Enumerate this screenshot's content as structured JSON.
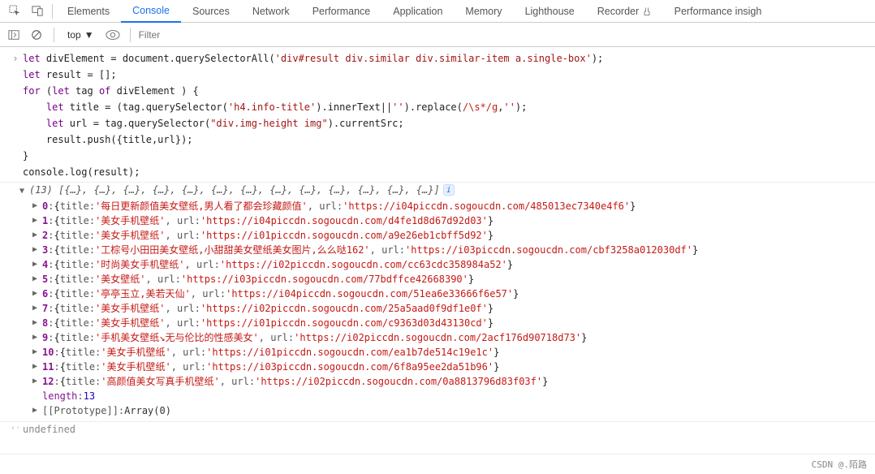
{
  "tabs": {
    "elements": "Elements",
    "console": "Console",
    "sources": "Sources",
    "network": "Network",
    "performance": "Performance",
    "application": "Application",
    "memory": "Memory",
    "lighthouse": "Lighthouse",
    "recorder": "Recorder",
    "perf_insights": "Performance insigh"
  },
  "toolbar": {
    "context": "top",
    "filter_placeholder": "Filter"
  },
  "code": {
    "l1a": "let",
    "l1b": " divElement = document.querySelectorAll(",
    "l1c": "'div#result div.similar div.similar-item a.single-box'",
    "l1d": ");",
    "l2a": "let",
    "l2b": " result = [];",
    "l3a": "for",
    "l3b": " (",
    "l3c": "let",
    "l3d": " tag ",
    "l3e": "of",
    "l3f": " divElement ) {",
    "l4a": "    let",
    "l4b": " title = (tag.querySelector(",
    "l4c": "'h4.info-title'",
    "l4d": ").innerText||",
    "l4e": "''",
    "l4f": ").replace(",
    "l4g": "/\\s*/g",
    "l4h": ",",
    "l4i": "''",
    "l4j": ");",
    "l5a": "    let",
    "l5b": " url = tag.querySelector(",
    "l5c": "\"div.img-height img\"",
    "l5d": ").currentSrc;",
    "l6": "    result.push({title,url});",
    "l7": "}",
    "l8": "console.log(result);"
  },
  "result": {
    "count": "(13)",
    "preview": " [{…}, {…}, {…}, {…}, {…}, {…}, {…}, {…}, {…}, {…}, {…}, {…}, {…}]",
    "items": [
      {
        "idx": "0",
        "title": "'每日更新颜值美女壁纸,男人看了都会珍藏颜值'",
        "url": "'https://i04piccdn.sogoucdn.com/485013ec7340e4f6'"
      },
      {
        "idx": "1",
        "title": "'美女手机壁纸'",
        "url": "'https://i04piccdn.sogoucdn.com/d4fe1d8d67d92d03'"
      },
      {
        "idx": "2",
        "title": "'美女手机壁纸'",
        "url": "'https://i01piccdn.sogoucdn.com/a9e26eb1cbff5d92'"
      },
      {
        "idx": "3",
        "title": "'工棕号小田田美女壁纸,小甜甜美女壁纸美女图片,么么哒162'",
        "url": "'https://i03piccdn.sogoucdn.com/cbf3258a012030df'"
      },
      {
        "idx": "4",
        "title": "'时尚美女手机壁纸'",
        "url": "'https://i02piccdn.sogoucdn.com/cc63cdc358984a52'"
      },
      {
        "idx": "5",
        "title": "'美女壁纸'",
        "url": "'https://i03piccdn.sogoucdn.com/77bdffce42668390'"
      },
      {
        "idx": "6",
        "title": "'亭亭玉立,美若天仙'",
        "url": "'https://i04piccdn.sogoucdn.com/51ea6e33666f6e57'"
      },
      {
        "idx": "7",
        "title": "'美女手机壁纸'",
        "url": "'https://i02piccdn.sogoucdn.com/25a5aad0f9df1e0f'"
      },
      {
        "idx": "8",
        "title": "'美女手机壁纸'",
        "url": "'https://i01piccdn.sogoucdn.com/c9363d03d43130cd'"
      },
      {
        "idx": "9",
        "title": "'手机美女壁纸↘无与伦比的性感美女'",
        "url": "'https://i02piccdn.sogoucdn.com/2acf176d90718d73'"
      },
      {
        "idx": "10",
        "title": "'美女手机壁纸'",
        "url": "'https://i01piccdn.sogoucdn.com/ea1b7de514c19e1c'"
      },
      {
        "idx": "11",
        "title": "'美女手机壁纸'",
        "url": "'https://i03piccdn.sogoucdn.com/6f8a95ee2da51b96'"
      },
      {
        "idx": "12",
        "title": "'高颜值美女写真手机壁纸'",
        "url": "'https://i02piccdn.sogoucdn.com/0a8813796d83f03f'"
      }
    ],
    "length_key": "length",
    "length_val": "13",
    "proto_label": "[[Prototype]]",
    "proto_val": "Array(0)",
    "title_key": "title: ",
    "url_key": "url: "
  },
  "footer": {
    "return_val": "undefined",
    "watermark": "CSDN @.陌路"
  }
}
